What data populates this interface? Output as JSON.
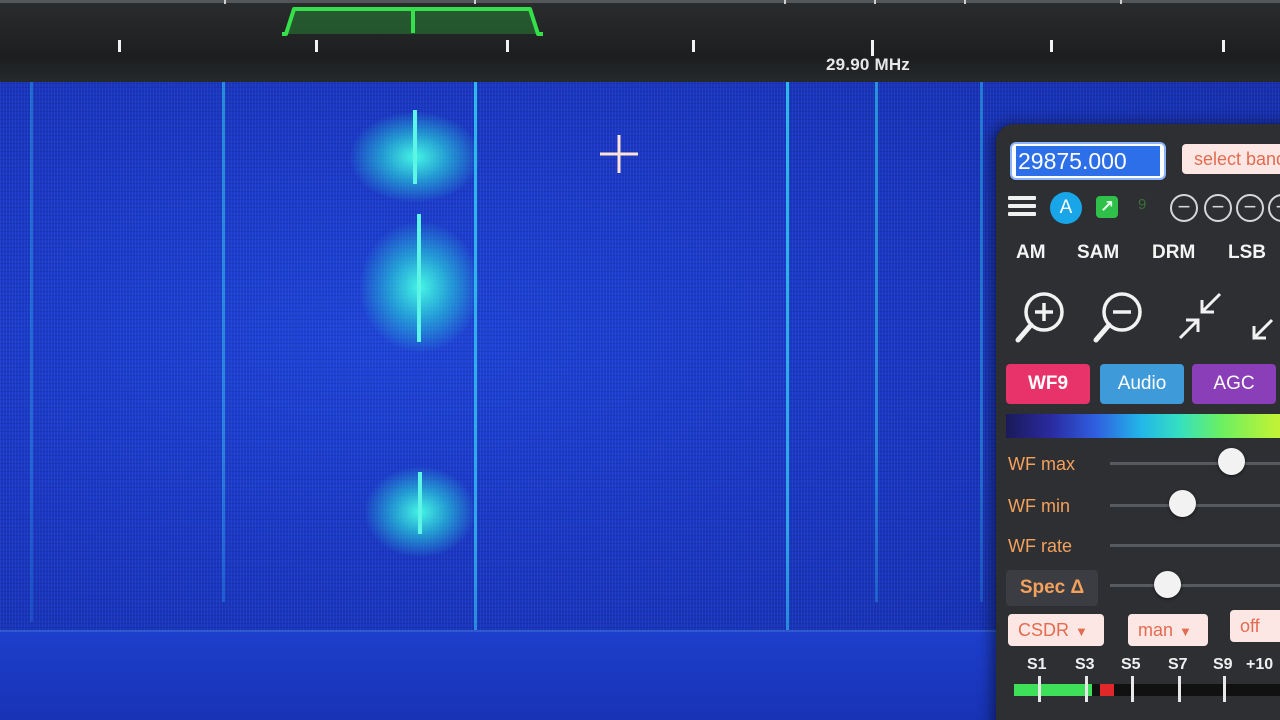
{
  "scale": {
    "label": "29.90 MHz"
  },
  "panel": {
    "frequency_value": "29875.000",
    "band_select_placeholder": "select band",
    "a_button_label": "A",
    "ext_icon": "external-link-icon",
    "modes": [
      "AM",
      "SAM",
      "DRM",
      "LSB"
    ],
    "tabs": {
      "wf": "WF9",
      "audio": "Audio",
      "agc": "AGC"
    },
    "sliders": {
      "wf_max_label": "WF max",
      "wf_max_level": 0.72,
      "wf_min_label": "WF min",
      "wf_min_level": 0.42,
      "wf_rate_label": "WF rate",
      "spec_label": "Spec Δ",
      "spec_level": 0.33
    },
    "dropdowns": {
      "waterfall_source": "CSDR",
      "agc_mode": "man",
      "agc_off": "off"
    },
    "smeter": {
      "labels": [
        "S1",
        "S3",
        "S5",
        "S7",
        "S9",
        "+10"
      ],
      "level": 0.27
    }
  },
  "colors": {
    "waterfall_blue": "#1a38c4",
    "signal_cyan": "#46ffe6",
    "passband_green": "#36e04a",
    "panel_bg": "#2d2f33",
    "wf_tab": "#e8336a",
    "audio_tab": "#3f9ad9",
    "agc_tab": "#8a3fb8",
    "slider_label": "#f3a15c"
  }
}
